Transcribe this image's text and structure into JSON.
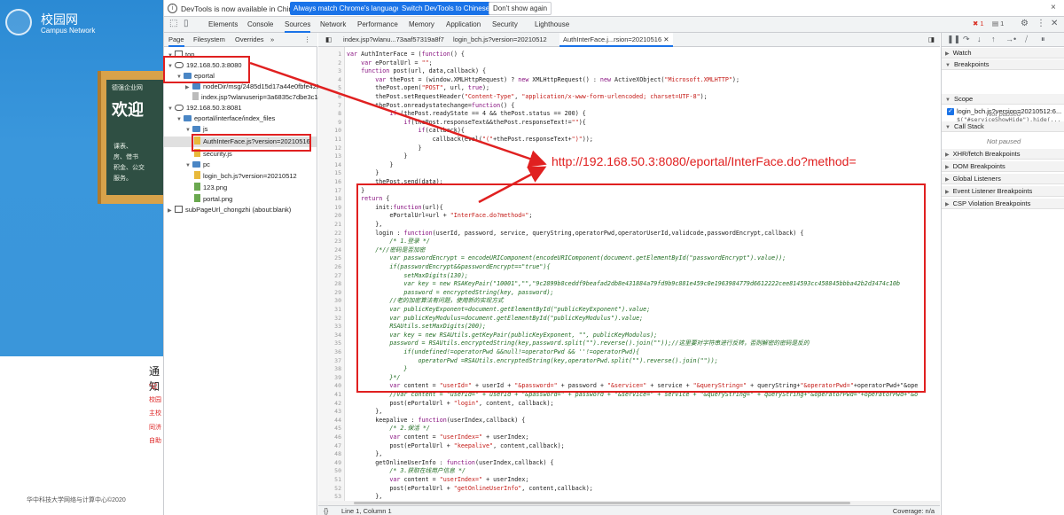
{
  "webpage": {
    "logo_cn": "校园网",
    "logo_en": "Campus Network",
    "board_sub": "德强企业网",
    "board_title": "欢迎",
    "board_lines": [
      "课表、",
      "房、借书",
      "积金、公交",
      "服务。"
    ],
    "notice_title": "通知",
    "notice_lines": [
      "“记",
      "校园",
      "主校",
      "同济",
      "自助"
    ],
    "footer": "华中科技大学网络与计算中心©2020"
  },
  "infobar": {
    "text": "DevTools is now available in Chinese!",
    "match_button": "Always match Chrome's language",
    "switch_button": "Switch DevTools to Chinese",
    "dont_button": "Don't show again",
    "close": "×"
  },
  "main_tabs": [
    "Elements",
    "Console",
    "Sources",
    "Network",
    "Performance",
    "Memory",
    "Application",
    "Security",
    "Lighthouse"
  ],
  "active_main_tab": "Sources",
  "error_count": "1",
  "message_count": "1",
  "navigator": {
    "tabs": [
      "Page",
      "Filesystem",
      "Overrides"
    ],
    "more": "»",
    "tree": [
      {
        "label": "top",
        "type": "frame"
      },
      {
        "label": "192.168.50.3:8080",
        "type": "cloud"
      },
      {
        "label": "eportal",
        "type": "folder"
      },
      {
        "label": "nodeDir/msg/2485d15d17a44e0fbfe426c",
        "type": "file"
      },
      {
        "label": "index.jsp?wlanuserip=3a6835c7dbe3c1df",
        "type": "file"
      },
      {
        "label": "192.168.50.3:8081",
        "type": "cloud"
      },
      {
        "label": "eportal/interface/index_files",
        "type": "folder"
      },
      {
        "label": "js",
        "type": "folder"
      },
      {
        "label": "AuthInterFace.js?version=20210516",
        "type": "file"
      },
      {
        "label": "security.js",
        "type": "file"
      },
      {
        "label": "pc",
        "type": "folder"
      },
      {
        "label": "login_bch.js?version=20210512",
        "type": "file"
      },
      {
        "label": "123.png",
        "type": "file"
      },
      {
        "label": "portal.png",
        "type": "file"
      },
      {
        "label": "subPageUrl_chongzhi (about:blank)",
        "type": "frame"
      }
    ]
  },
  "editor_tabs": [
    "index.jsp?wlanu...73aaf57319a8f7",
    "login_bch.js?version=20210512",
    "AuthInterFace.j...rsion=20210516"
  ],
  "active_editor_tab": "AuthInterFace.j...rsion=20210516",
  "code": [
    {
      "n": "1",
      "t": "var AuthInterFace = (function() {"
    },
    {
      "n": "2",
      "t": "    var ePortalUrl = \"\";"
    },
    {
      "n": "3",
      "t": "    function post(url, data,callback) {"
    },
    {
      "n": "4",
      "t": "        var thePost = (window.XMLHttpRequest) ? new XMLHttpRequest() : new ActiveXObject(\"Microsoft.XMLHTTP\");"
    },
    {
      "n": "5",
      "t": "        thePost.open(\"POST\", url, true);"
    },
    {
      "n": "6",
      "t": "        thePost.setRequestHeader(\"Content-Type\", \"application/x-www-form-urlencoded; charset=UTF-8\");"
    },
    {
      "n": "7",
      "t": "        thePost.onreadystatechange=function() {"
    },
    {
      "n": "8",
      "t": "            if (thePost.readyState == 4 && thePost.status == 200) {"
    },
    {
      "n": "9",
      "t": "                if(thePost.responseText&&thePost.responseText!=\"\"){"
    },
    {
      "n": "10",
      "t": "                    if(callback){"
    },
    {
      "n": "11",
      "t": "                        callback(eval(\"(\"+thePost.responseText+\")\"));"
    },
    {
      "n": "12",
      "t": "                    }"
    },
    {
      "n": "13",
      "t": "                }"
    },
    {
      "n": "14",
      "t": "            }"
    },
    {
      "n": "15",
      "t": "        }"
    },
    {
      "n": "16",
      "t": "        thePost.send(data);"
    },
    {
      "n": "17",
      "t": "    }"
    },
    {
      "n": "18",
      "t": "    return {"
    },
    {
      "n": "19",
      "t": "        init:function(url){"
    },
    {
      "n": "20",
      "t": "            ePortalUrl=url + \"InterFace.do?method=\";"
    },
    {
      "n": "21",
      "t": "        },"
    },
    {
      "n": "22",
      "t": "        login : function(userId, password, service, queryString,operatorPwd,operatorUserId,validcode,passwordEncrypt,callback) {"
    },
    {
      "n": "23",
      "t": "            /* 1.登录 */"
    },
    {
      "n": "24",
      "t": "        /*//密码是否加密"
    },
    {
      "n": "25",
      "t": "            var passwordEncrypt = encodeURIComponent(encodeURIComponent(document.getElementById(\"passwordEncrypt\").value));"
    },
    {
      "n": "26",
      "t": "            if(passwordEncrypt&&passwordEncrypt==\"true\"){"
    },
    {
      "n": "27",
      "t": "                setMaxDigits(130);"
    },
    {
      "n": "28",
      "t": "                var key = new RSAKeyPair(\"10001\",\"\",\"9c2899b8ceddf9beafad2db8e431884a79fd9b9c881e459c0e1963984779d6612222cee814593cc458845bbba42b2d3474c10b"
    },
    {
      "n": "29",
      "t": "                password = encryptedString(key, password);"
    },
    {
      "n": "30",
      "t": "            //老的加密算法有问题，使用新的实现方式"
    },
    {
      "n": "31",
      "t": "            var publicKeyExponent=document.getElementById(\"publicKeyExponent\").value;"
    },
    {
      "n": "32",
      "t": "            var publicKeyModulus=document.getElementById(\"publicKeyModulus\").value;"
    },
    {
      "n": "33",
      "t": "            RSAUtils.setMaxDigits(200);"
    },
    {
      "n": "34",
      "t": "            var key = new RSAUtils.getKeyPair(publicKeyExponent, \"\", publicKeyModulus);"
    },
    {
      "n": "35",
      "t": "            password = RSAUtils.encryptedString(key,password.split(\"\").reverse().join(\"\"));//这里要对字符串进行反转，否则解密的密码是反的"
    },
    {
      "n": "36",
      "t": "                if(undefined!=operatorPwd &&null!=operatorPwd && ''!=operatorPwd){"
    },
    {
      "n": "37",
      "t": "                    operatorPwd =RSAUtils.encryptedString(key,operatorPwd.split(\"\").reverse().join(\"\"));"
    },
    {
      "n": "38",
      "t": "                }"
    },
    {
      "n": "39",
      "t": "            }*/"
    },
    {
      "n": "40",
      "t": "            var content = \"userId=\" + userId + \"&password=\" + password + \"&service=\" + service + \"&queryString=\" + queryString+\"&operatorPwd=\"+operatorPwd+\"&ope"
    },
    {
      "n": "41",
      "t": "            //var content = \"userId=\" + userId + \"&password=\" + password + \"&service=\" + service + \"&queryString=\" + queryString+\"&operatorPwd=\"+operatorPwd+\"&o"
    },
    {
      "n": "42",
      "t": "            post(ePortalUrl + \"login\", content, callback);"
    },
    {
      "n": "43",
      "t": "        },"
    },
    {
      "n": "44",
      "t": "        keepalive : function(userIndex,callback) {"
    },
    {
      "n": "45",
      "t": "            /* 2.保活 */"
    },
    {
      "n": "46",
      "t": "            var content = \"userIndex=\" + userIndex;"
    },
    {
      "n": "47",
      "t": "            post(ePortalUrl + \"keepalive\", content,callback);"
    },
    {
      "n": "48",
      "t": "        },"
    },
    {
      "n": "49",
      "t": "        getOnlineUserInfo : function(userIndex,callback) {"
    },
    {
      "n": "50",
      "t": "            /* 3.获取在线用户信息 */"
    },
    {
      "n": "51",
      "t": "            var content = \"userIndex=\" + userIndex;"
    },
    {
      "n": "52",
      "t": "            post(ePortalUrl + \"getOnlineUserInfo\", content,callback);"
    },
    {
      "n": "53",
      "t": "        },"
    },
    {
      "n": "54",
      "t": "        freshOnlineUserInfo : function(userIndex,callback) {"
    },
    {
      "n": "55",
      "t": "            var content = \"userIndex=\" + userIndex;"
    }
  ],
  "statusbar": {
    "brace": "{}",
    "position": "Line 1, Column 1",
    "coverage": "Coverage: n/a"
  },
  "sidebar": {
    "watch": "Watch",
    "breakpoints": "Breakpoints",
    "bp_file": "login_bch.js?version=20210512:6...",
    "bp_code": "$(\"#serviceShowHide\").hide(...",
    "scope": "Scope",
    "not_paused_1": "Not paused",
    "call_stack": "Call Stack",
    "not_paused_2": "Not paused",
    "sections": [
      "XHR/fetch Breakpoints",
      "DOM Breakpoints",
      "Global Listeners",
      "Event Listener Breakpoints",
      "CSP Violation Breakpoints"
    ]
  },
  "annotation": {
    "url": "http://192.168.50.3:8080/eportal/InterFace.do?method=",
    "color": "#e02020"
  },
  "colors": {
    "accent": "#1a73e8",
    "annotation": "#e02020",
    "banner": "#3a97dc"
  }
}
